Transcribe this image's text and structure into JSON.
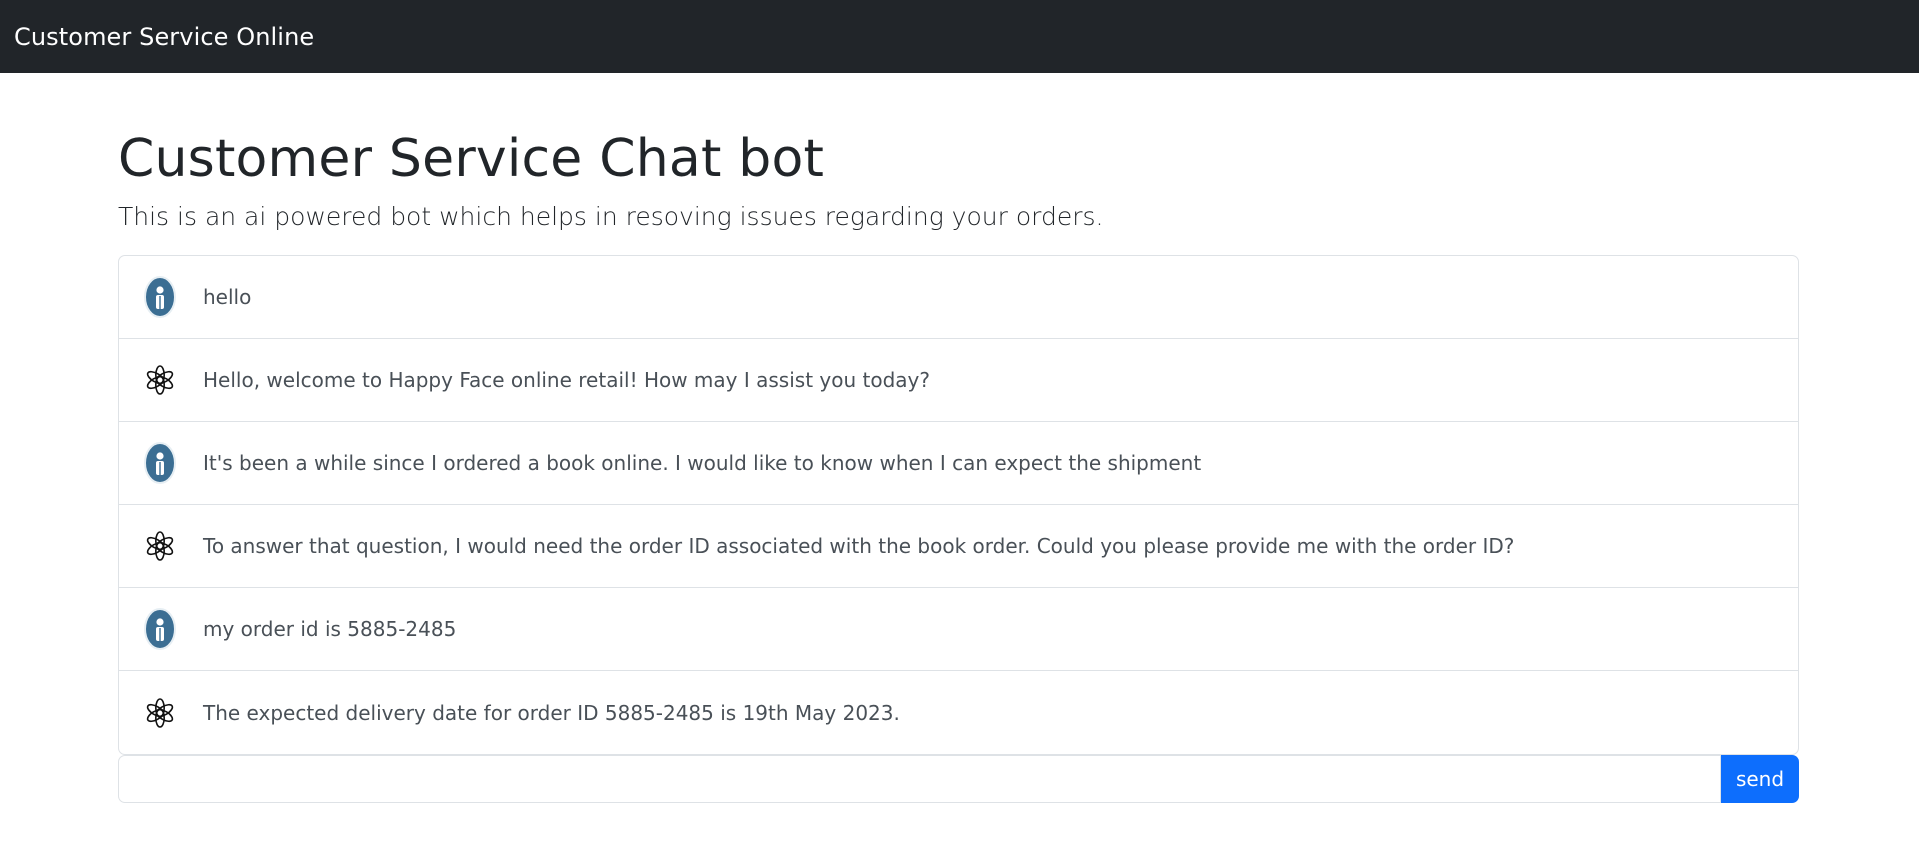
{
  "navbar": {
    "brand": "Customer Service Online"
  },
  "main": {
    "title": "Customer Service Chat bot",
    "lead": "This is an ai powered bot which helps in resoving issues regarding your orders."
  },
  "chat": {
    "messages": [
      {
        "sender": "user",
        "icon": "user-avatar-icon",
        "text": "hello"
      },
      {
        "sender": "bot",
        "icon": "openai-logo-icon",
        "text": "Hello, welcome to Happy Face online retail! How may I assist you today?"
      },
      {
        "sender": "user",
        "icon": "user-avatar-icon",
        "text": "It's been a while since I ordered a book online. I would like to know when I can expect the shipment"
      },
      {
        "sender": "bot",
        "icon": "openai-logo-icon",
        "text": "To answer that question, I would need the order ID associated with the book order. Could you please provide me with the order ID?"
      },
      {
        "sender": "user",
        "icon": "user-avatar-icon",
        "text": "my order id is 5885-2485"
      },
      {
        "sender": "bot",
        "icon": "openai-logo-icon",
        "text": "The expected delivery date for order ID 5885-2485 is 19th May 2023."
      }
    ]
  },
  "composer": {
    "value": "",
    "placeholder": "",
    "send_label": "send"
  },
  "colors": {
    "navbar_bg": "#212529",
    "primary": "#0d6efd",
    "user_avatar": "#3b6e93"
  }
}
